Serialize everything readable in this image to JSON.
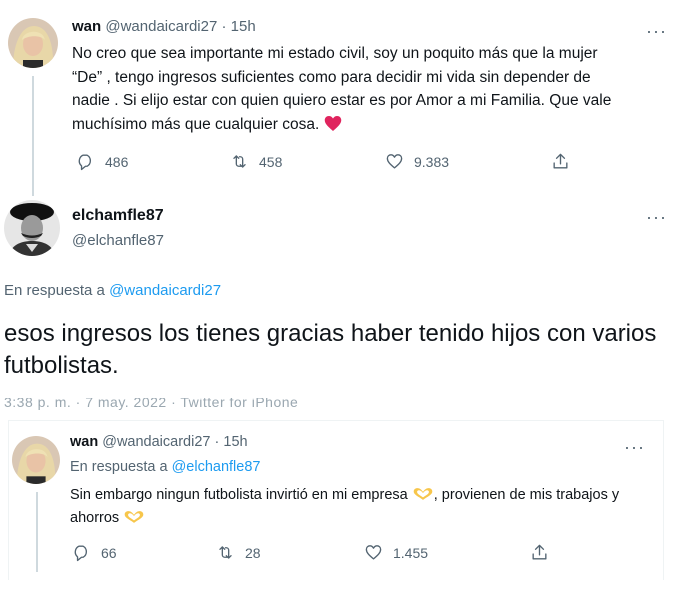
{
  "tweet1": {
    "display_name": "wan",
    "handle": "@wandaicardi27",
    "separator": "·",
    "time": "15h",
    "more_icon": "ellipsis-icon",
    "text": "No creo que sea importante mi estado civil, soy un poquito más que la mujer “De” , tengo ingresos suficientes como para decidir mi vida sin depender de nadie . Si elijo estar con quien quiero estar es por Amor a mi Familia. Que vale muchísimo más que cualquier cosa.",
    "emoji": "red-heart",
    "stats": {
      "replies": "486",
      "retweets": "458",
      "likes": "9.383"
    }
  },
  "tweet2": {
    "display_name": "elchamfle87",
    "handle": "@elchanfle87",
    "more_icon": "ellipsis-icon",
    "reply_prefix": "En respuesta a",
    "reply_to": "@wandaicardi27",
    "text": "esos ingresos los tienes gracias haber tenido hijos con varios futbolistas.",
    "cut_meta": "3:38 p. m. · 7 may. 2022 · Twitter for iPhone"
  },
  "tweet3": {
    "display_name": "wan",
    "handle": "@wandaicardi27",
    "separator": "·",
    "time": "15h",
    "more_icon": "ellipsis-icon",
    "reply_prefix": "En respuesta a",
    "reply_to": "@elchanfle87",
    "text_part1": "Sin embargo ningun futbolista invirtió en mi empresa",
    "text_part2": ", provienen de mis trabajos y ahorros",
    "emoji": "heart-hands",
    "stats": {
      "replies": "66",
      "retweets": "28",
      "likes": "1.455"
    }
  },
  "colors": {
    "text": "#0f1419",
    "muted": "#536471",
    "link": "#1d9bf0",
    "heart": "#e0245e",
    "divider": "#cfd9de"
  }
}
